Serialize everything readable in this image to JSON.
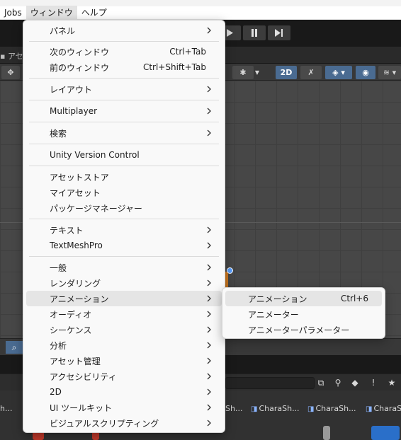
{
  "menubar": {
    "items": [
      "Jobs",
      "ウィンドウ",
      "ヘルプ"
    ]
  },
  "tabs": {
    "assets_partial": "アセ"
  },
  "scene_toolbar": {
    "mode_2d": "2D"
  },
  "window_menu": {
    "items": [
      {
        "label": "パネル",
        "submenu": true
      },
      {
        "label": "次のウィンドウ",
        "shortcut": "Ctrl+Tab"
      },
      {
        "label": "前のウィンドウ",
        "shortcut": "Ctrl+Shift+Tab"
      },
      {
        "label": "レイアウト",
        "submenu": true
      },
      {
        "label": "Multiplayer",
        "submenu": true
      },
      {
        "label": "検索",
        "submenu": true
      },
      {
        "label": "Unity Version Control"
      },
      {
        "label": "アセットストア"
      },
      {
        "label": "マイアセット"
      },
      {
        "label": "パッケージマネージャー"
      },
      {
        "label": "テキスト",
        "submenu": true
      },
      {
        "label": "TextMeshPro",
        "submenu": true
      },
      {
        "label": "一般",
        "submenu": true
      },
      {
        "label": "レンダリング",
        "submenu": true
      },
      {
        "label": "アニメーション",
        "submenu": true,
        "highlighted": true
      },
      {
        "label": "オーディオ",
        "submenu": true
      },
      {
        "label": "シーケンス",
        "submenu": true
      },
      {
        "label": "分析",
        "submenu": true
      },
      {
        "label": "アセット管理",
        "submenu": true
      },
      {
        "label": "アクセシビリティ",
        "submenu": true
      },
      {
        "label": "2D",
        "submenu": true
      },
      {
        "label": "UI ツールキット",
        "submenu": true
      },
      {
        "label": "ビジュアルスクリプティング",
        "submenu": true
      }
    ]
  },
  "animation_submenu": {
    "items": [
      {
        "label": "アニメーション",
        "shortcut": "Ctrl+6",
        "highlighted": true
      },
      {
        "label": "アニメーター"
      },
      {
        "label": "アニメーターパラメーター"
      }
    ]
  },
  "project_assets": {
    "labels": [
      "h...",
      "Sh...",
      "CharaSh...",
      "CharaSh...",
      "CharaSh"
    ]
  },
  "colors": {
    "menu_bg": "#f9f9f9",
    "highlight": "#e5e5e5",
    "accent_blue": "#4a6b91",
    "editor_dark": "#1e1e1e"
  }
}
